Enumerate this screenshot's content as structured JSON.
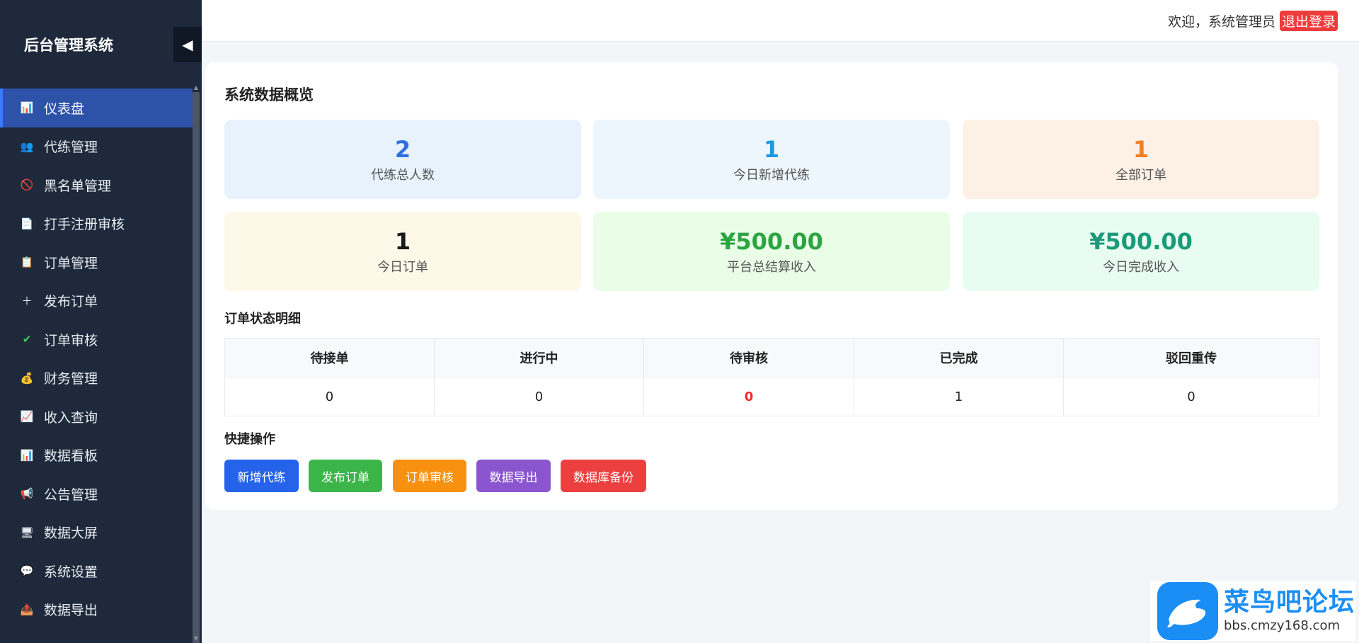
{
  "sidebar": {
    "title": "后台管理系统",
    "collapse_icon": "◀",
    "items": [
      {
        "icon": "📊",
        "label": "仪表盘",
        "active": true
      },
      {
        "icon": "👥",
        "label": "代练管理"
      },
      {
        "icon": "🚫",
        "label": "黑名单管理"
      },
      {
        "icon": "📄",
        "label": "打手注册审核"
      },
      {
        "icon": "📋",
        "label": "订单管理"
      },
      {
        "icon": "＋",
        "label": "发布订单"
      },
      {
        "icon": "✔",
        "label": "订单审核"
      },
      {
        "icon": "💰",
        "label": "财务管理"
      },
      {
        "icon": "📈",
        "label": "收入查询"
      },
      {
        "icon": "📊",
        "label": "数据看板"
      },
      {
        "icon": "📢",
        "label": "公告管理"
      },
      {
        "icon": "🖥",
        "label": "数据大屏"
      },
      {
        "icon": "💬",
        "label": "系统设置"
      },
      {
        "icon": "📤",
        "label": "数据导出"
      }
    ]
  },
  "topbar": {
    "welcome": "欢迎，系统管理员",
    "logout": "退出登录"
  },
  "overview": {
    "title": "系统数据概览",
    "stats": [
      {
        "value": "2",
        "label": "代练总人数",
        "color": "#2f6fe0",
        "bg": "#e7f2fd"
      },
      {
        "value": "1",
        "label": "今日新增代练",
        "color": "#1a9ae0",
        "bg": "#edf6fd"
      },
      {
        "value": "1",
        "label": "全部订单",
        "color": "#f07f22",
        "bg": "#fdf1e6"
      },
      {
        "value": "1",
        "label": "今日订单",
        "color": "#1a1a1a",
        "bg": "#fef8e8"
      },
      {
        "value": "¥500.00",
        "label": "平台总结算收入",
        "color": "#2aa541",
        "bg": "#e9fde7"
      },
      {
        "value": "¥500.00",
        "label": "今日完成收入",
        "color": "#1b9a7a",
        "bg": "#e8fcf2"
      }
    ]
  },
  "order_status": {
    "title": "订单状态明细",
    "headers": [
      "待接单",
      "进行中",
      "待审核",
      "已完成",
      "驳回重传"
    ],
    "values": [
      "0",
      "0",
      "0",
      "1",
      "0"
    ]
  },
  "quick_actions": {
    "title": "快捷操作",
    "buttons": [
      {
        "label": "新增代练",
        "color": "#2563eb"
      },
      {
        "label": "发布订单",
        "color": "#3bb54a"
      },
      {
        "label": "订单审核",
        "color": "#f7910f"
      },
      {
        "label": "数据导出",
        "color": "#8a55cf"
      },
      {
        "label": "数据库备份",
        "color": "#ec4040"
      }
    ]
  },
  "watermark": {
    "name": "菜鸟吧论坛",
    "url": "bbs.cmzy168.com"
  }
}
